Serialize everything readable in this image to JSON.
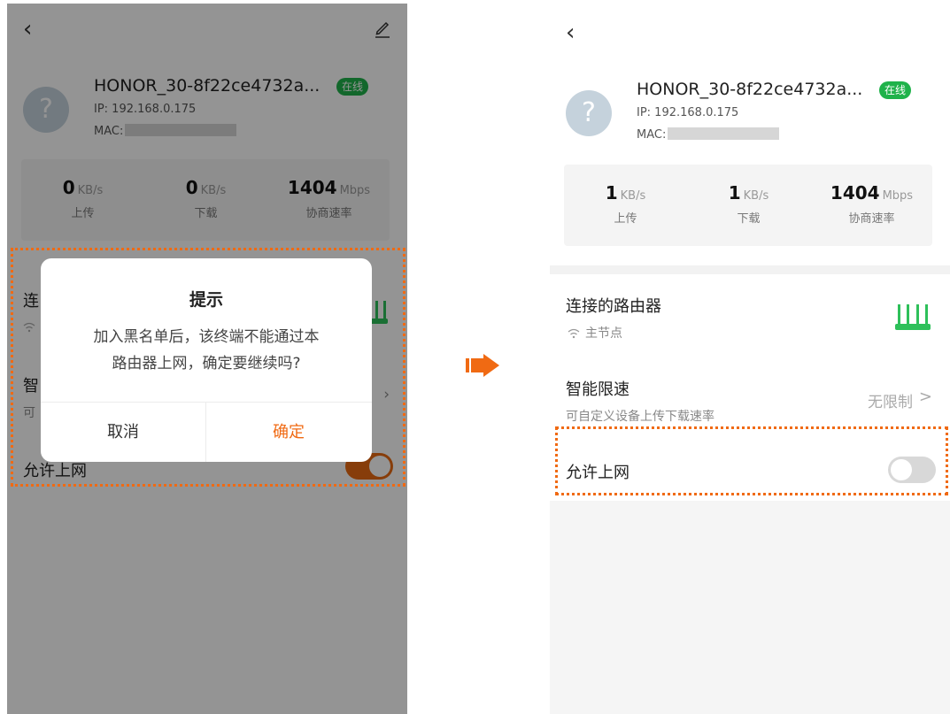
{
  "colors": {
    "accent": "#f06a13",
    "online": "#1fb24a",
    "router": "#2ec05a",
    "toggle_on": "#e86a12",
    "toggle_off": "#d8d8d8"
  },
  "icons": {
    "back": "chevron-left-icon",
    "edit": "pencil-icon",
    "avatar": "question-mark-icon",
    "router": "router-antenna-icon",
    "wifi": "wifi-icon",
    "arrow": "right-arrow-icon"
  },
  "left": {
    "device": {
      "name": "HONOR_30-8f22ce4732a...",
      "status": "在线",
      "avatar_glyph": "?",
      "ip": "IP: 192.168.0.175",
      "mac_label": "MAC:"
    },
    "stats": [
      {
        "value": "0",
        "unit": "KB/s",
        "label": "上传"
      },
      {
        "value": "0",
        "unit": "KB/s",
        "label": "下载"
      },
      {
        "value": "1404",
        "unit": "Mbps",
        "label": "协商速率"
      }
    ],
    "rows": {
      "router_partial": "连",
      "limit_partial": "智",
      "limit_sub_partial": "可",
      "allow": "允许上网"
    },
    "toggle_on": true,
    "dialog": {
      "title": "提示",
      "message_line1": "加入黑名单后，该终端不能通过本",
      "message_line2": "路由器上网，确定要继续吗?",
      "cancel": "取消",
      "confirm": "确定"
    }
  },
  "right": {
    "device": {
      "name": "HONOR_30-8f22ce4732a...",
      "status": "在线",
      "avatar_glyph": "?",
      "ip": "IP: 192.168.0.175",
      "mac_label": "MAC:"
    },
    "stats": [
      {
        "value": "1",
        "unit": "KB/s",
        "label": "上传"
      },
      {
        "value": "1",
        "unit": "KB/s",
        "label": "下载"
      },
      {
        "value": "1404",
        "unit": "Mbps",
        "label": "协商速率"
      }
    ],
    "connected_router": {
      "title": "连接的路由器",
      "sub": "主节点"
    },
    "speed_limit": {
      "title": "智能限速",
      "sub": "可自定义设备上传下载速率",
      "value": "无限制",
      "chevron": ">"
    },
    "allow": {
      "title": "允许上网"
    },
    "toggle_on": false
  }
}
